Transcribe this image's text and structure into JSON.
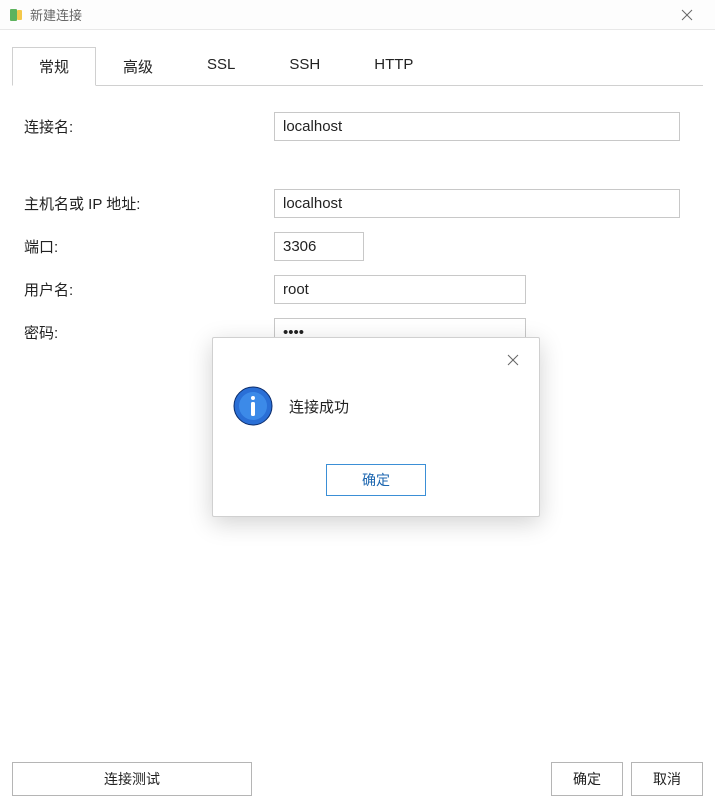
{
  "window": {
    "title": "新建连接"
  },
  "tabs": [
    {
      "label": "常规",
      "active": true
    },
    {
      "label": "高级",
      "active": false
    },
    {
      "label": "SSL",
      "active": false
    },
    {
      "label": "SSH",
      "active": false
    },
    {
      "label": "HTTP",
      "active": false
    }
  ],
  "form": {
    "connection_name_label": "连接名:",
    "connection_name_value": "localhost",
    "host_label": "主机名或 IP 地址:",
    "host_value": "localhost",
    "port_label": "端口:",
    "port_value": "3306",
    "username_label": "用户名:",
    "username_value": "root",
    "password_label": "密码:",
    "password_value": "••••"
  },
  "buttons": {
    "test_connection": "连接测试",
    "ok": "确定",
    "cancel": "取消"
  },
  "modal": {
    "message": "连接成功",
    "ok": "确定"
  }
}
